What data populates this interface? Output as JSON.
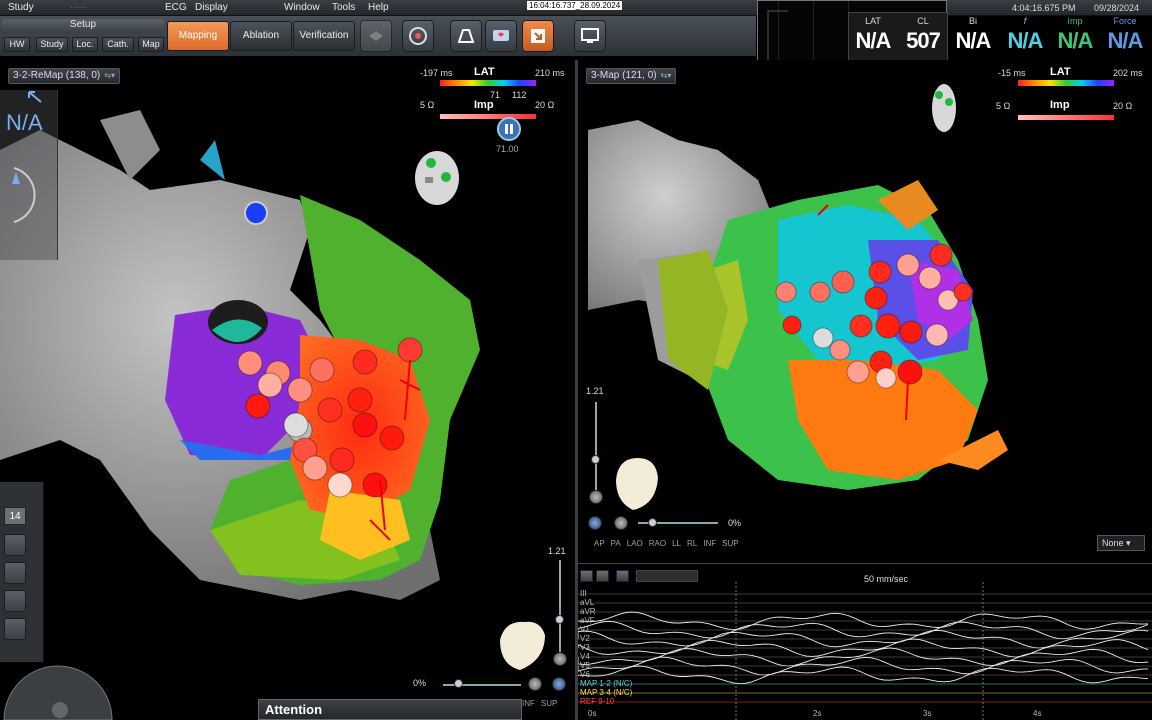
{
  "menu": {
    "study": "Study",
    "ecg": "ECG",
    "display": "Display",
    "window": "Window",
    "tools": "Tools",
    "help": "Help"
  },
  "clock_center": "16:04:16.737_28.09.2024",
  "clock_right": "4:04:16.675 PM",
  "date_right": "09/28/2024",
  "toolbar": {
    "setup": "Setup",
    "hw": "HW",
    "study": "Study",
    "loc": "Loc.",
    "cath": "Cath.",
    "map": "Map",
    "mapping": "Mapping",
    "ablation": "Ablation",
    "verification": "Verification"
  },
  "readout": {
    "lat_label": "LAT",
    "lat_value": "N/A",
    "cl_label": "CL",
    "cl_value": "507",
    "bi_label": "Bi",
    "bi_value": "N/A",
    "f_label": "f",
    "f_value": "N/A",
    "imp_label": "Imp",
    "imp_value": "N/A",
    "force_label": "Force",
    "force_value": "N/A"
  },
  "left_map": {
    "title": "3-2-ReMap (138, 0)",
    "lat_min": "-197 ms",
    "lat_title": "LAT",
    "lat_max": "210 ms",
    "lat_marker_1": "71",
    "lat_marker_2": "112",
    "imp_min": "5 Ω",
    "imp_title": "Imp",
    "imp_max": "20 Ω",
    "pause_value": "71.00",
    "na_text": "N/A",
    "toolbox_number": "14",
    "zoom": "1.21",
    "percent": "0%",
    "views": [
      "INF",
      "SUP"
    ]
  },
  "right_map": {
    "title": "3-Map (121, 0)",
    "lat_min": "-15 ms",
    "lat_title": "LAT",
    "lat_max": "202 ms",
    "imp_min": "5 Ω",
    "imp_title": "Imp",
    "imp_max": "20 Ω",
    "zoom": "1.21",
    "percent": "0%",
    "views": [
      "AP",
      "PA",
      "LAO",
      "RAO",
      "LL",
      "RL",
      "INF",
      "SUP"
    ],
    "dropdown": "None"
  },
  "attention": "Attention",
  "ecg": {
    "speed": "50 mm/sec",
    "leads": [
      "III",
      "aVL",
      "aVR",
      "aVF",
      "V1",
      "V2",
      "V3",
      "V4",
      "V5",
      "V6",
      "MAP 1-2 (N/C)",
      "MAP 3-4 (N/C)",
      "REF 9-10"
    ],
    "times": [
      "0s",
      "2s",
      "3s",
      "4s"
    ]
  },
  "colors": {
    "accent_orange": "#e8773a",
    "readout_cyan": "#4fcfe3",
    "readout_green": "#3cc873",
    "readout_blue": "#5c9ae6"
  }
}
